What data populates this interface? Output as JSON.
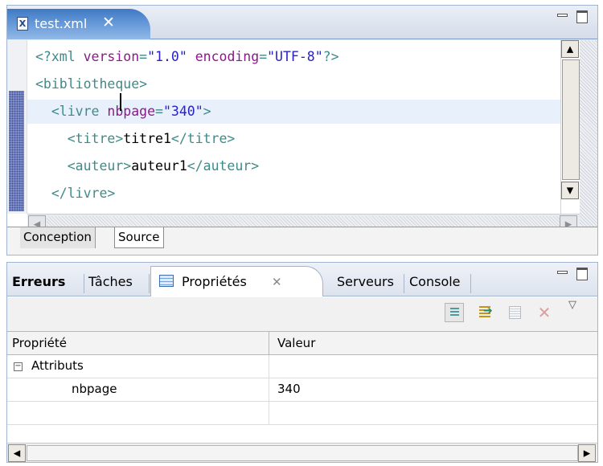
{
  "editor": {
    "tab_label": "test.xml",
    "tab_close_glyph": "✕",
    "file_icon_letter": "X",
    "bottom_tabs": [
      "Conception",
      "Source"
    ],
    "active_bottom_tab": "Source",
    "lines": [
      {
        "parts": [
          [
            "t",
            "<?xml "
          ],
          [
            "a",
            "version"
          ],
          [
            "t",
            "="
          ],
          [
            "v",
            "\"1.0\""
          ],
          [
            "t",
            " "
          ],
          [
            "a",
            "encoding"
          ],
          [
            "t",
            "="
          ],
          [
            "v",
            "\"UTF-8\""
          ],
          [
            "t",
            "?>"
          ]
        ]
      },
      {
        "parts": [
          [
            "t",
            "<bibliotheque>"
          ]
        ]
      },
      {
        "parts": [
          [
            "t",
            "  <livre "
          ],
          [
            "a",
            "nbpage"
          ],
          [
            "t",
            "="
          ],
          [
            "v",
            "\"340\""
          ],
          [
            "t",
            ">"
          ]
        ]
      },
      {
        "parts": [
          [
            "t",
            "    <titre>"
          ],
          [
            "txt",
            "titre1"
          ],
          [
            "t",
            "</titre>"
          ]
        ]
      },
      {
        "parts": [
          [
            "t",
            "    <auteur>"
          ],
          [
            "txt",
            "auteur1"
          ],
          [
            "t",
            "</auteur>"
          ]
        ]
      },
      {
        "parts": [
          [
            "t",
            "  </livre>"
          ]
        ]
      }
    ],
    "current_line": 2
  },
  "views": {
    "tabs": {
      "erreurs": "Erreurs",
      "taches": "Tâches",
      "proprietes": "Propriétés",
      "serveurs": "Serveurs",
      "console": "Console"
    },
    "active_tab": "Propriétés",
    "close_glyph": "✕",
    "toolbar": {
      "icons": [
        "show-categories-icon",
        "show-advanced-icon",
        "restore-default-icon",
        "delete-icon",
        "view-menu-icon"
      ]
    },
    "table": {
      "headers": [
        "Propriété",
        "Valeur"
      ],
      "rows": [
        {
          "property": "Attributs",
          "value": "",
          "expander": "−",
          "indent": 0
        },
        {
          "property": "nbpage",
          "value": "340",
          "indent": 1
        },
        {
          "property": "",
          "value": ""
        }
      ]
    }
  },
  "colors": {
    "tag": "#3f8a8a",
    "attribute": "#8a1a8a",
    "value": "#2a22c8",
    "active_tab": "#3f79c4"
  }
}
